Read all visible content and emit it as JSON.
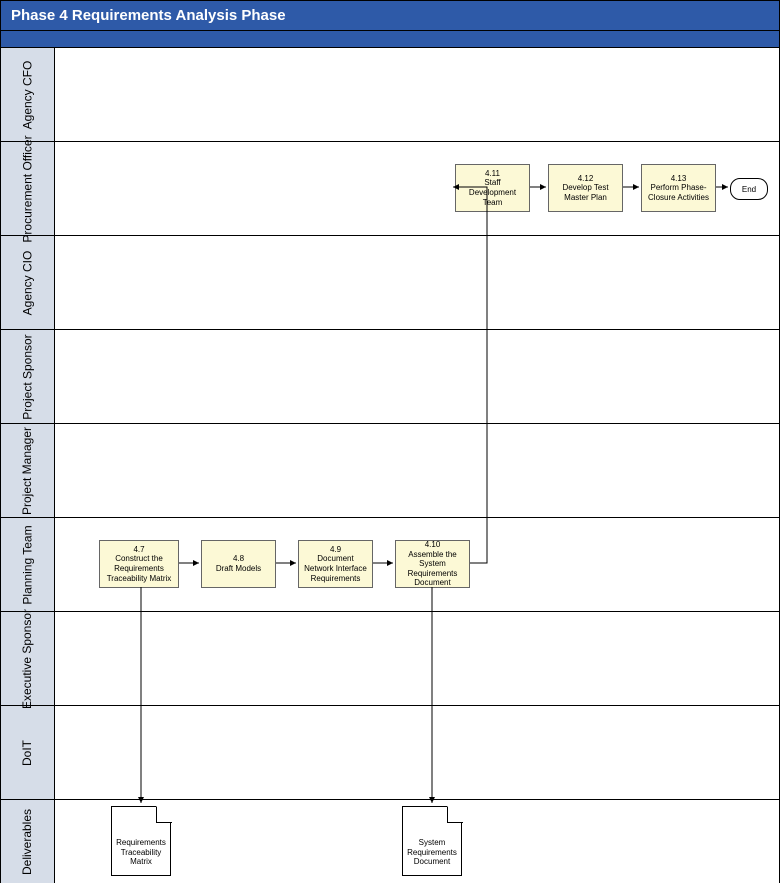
{
  "title": "Phase 4 Requirements Analysis Phase",
  "lanes": {
    "cfo": "Agency CFO",
    "procurement": "Procurement Officer",
    "cio": "Agency CIO",
    "sponsor": "Project Sponsor",
    "pm": "Project Manager",
    "planning": "Planning Team",
    "exec": "Executive Sponsor",
    "doit": "DoIT",
    "deliverables": "Deliverables"
  },
  "activities": {
    "a47": {
      "id": "4.7",
      "name": "Construct the Requirements Traceability Matrix"
    },
    "a48": {
      "id": "4.8",
      "name": "Draft Models"
    },
    "a49": {
      "id": "4.9",
      "name": "Document Network Interface Requirements"
    },
    "a410": {
      "id": "4.10",
      "name": "Assemble the System Requirements Document"
    },
    "a411": {
      "id": "4.11",
      "name": "Staff Development Team"
    },
    "a412": {
      "id": "4.12",
      "name": "Develop Test Master Plan"
    },
    "a413": {
      "id": "4.13",
      "name": "Perform Phase-Closure Activities"
    }
  },
  "end": "End",
  "deliverables": {
    "d1": "Requirements Traceability Matrix",
    "d2": "System Requirements Document"
  }
}
